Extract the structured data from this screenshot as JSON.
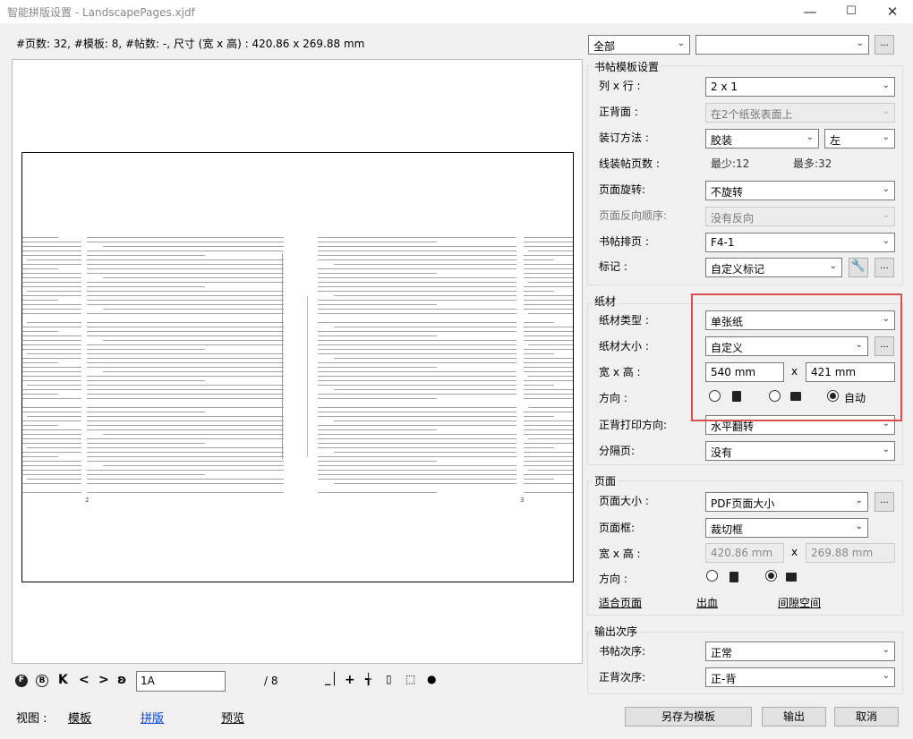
{
  "window": {
    "title": "智能拼版设置 - LandscapePages.xjdf"
  },
  "info": "#页数: 32, #模板: 8, #帖数: -, 尺寸 (宽 x 高) : 420.86 x 269.88 mm",
  "preview": {
    "left_page_number": "2",
    "right_page_number": "3"
  },
  "nav": {
    "page_value": "1A",
    "page_total": "/ 8"
  },
  "view": {
    "label": "视图 :",
    "tabs": [
      "模板",
      "拼版",
      "预览"
    ]
  },
  "buttons": {
    "save_template": "另存为模板",
    "output": "输出",
    "cancel": "取消",
    "more": "..."
  },
  "filter": {
    "scope": "全部",
    "second": ""
  },
  "signature": {
    "title": "书帖模板设置",
    "cols_rows_label": "列 x 行 :",
    "cols_rows": "2 x 1",
    "sides_label": "正背面 :",
    "sides": "在2个纸张表面上",
    "binding_label": "装订方法 :",
    "binding": "胶装",
    "binding_side": "左",
    "pages_label": "线装帖页数 :",
    "min": "最少:12",
    "max": "最多:32",
    "rotation_label": "页面旋转:",
    "rotation": "不旋转",
    "reverse_label": "页面反向顺序:",
    "reverse": "没有反向",
    "fold_label": "书帖排页 :",
    "fold": "F4-1",
    "marks_label": "标记 :",
    "marks": "自定义标记"
  },
  "paper": {
    "title": "纸材",
    "type_label": "纸材类型 :",
    "type": "单张纸",
    "size_label": "纸材大小 :",
    "size": "自定义",
    "wh_label": "宽 x 高 :",
    "width": "540 mm",
    "height": "421 mm",
    "x": "x",
    "orient_label": "方向 :",
    "auto_label": "自动",
    "work_label": "正背打印方向:",
    "work": "水平翻转",
    "separator_label": "分隔页:",
    "separator": "没有"
  },
  "page": {
    "title": "页面",
    "size_label": "页面大小 :",
    "size": "PDF页面大小",
    "box_label": "页面框:",
    "box": "裁切框",
    "wh_label": "宽 x 高 :",
    "width": "420.86 mm",
    "height": "269.88 mm",
    "x": "x",
    "orient_label": "方向 :",
    "links": [
      "适合页面",
      "出血",
      "间隙空间"
    ]
  },
  "output": {
    "title": "输出次序",
    "sig_order_label": "书帖次序:",
    "sig_order": "正常",
    "side_order_label": "正背次序:",
    "side_order": "正-背"
  },
  "colors": {
    "highlight": "#e04b4b"
  }
}
